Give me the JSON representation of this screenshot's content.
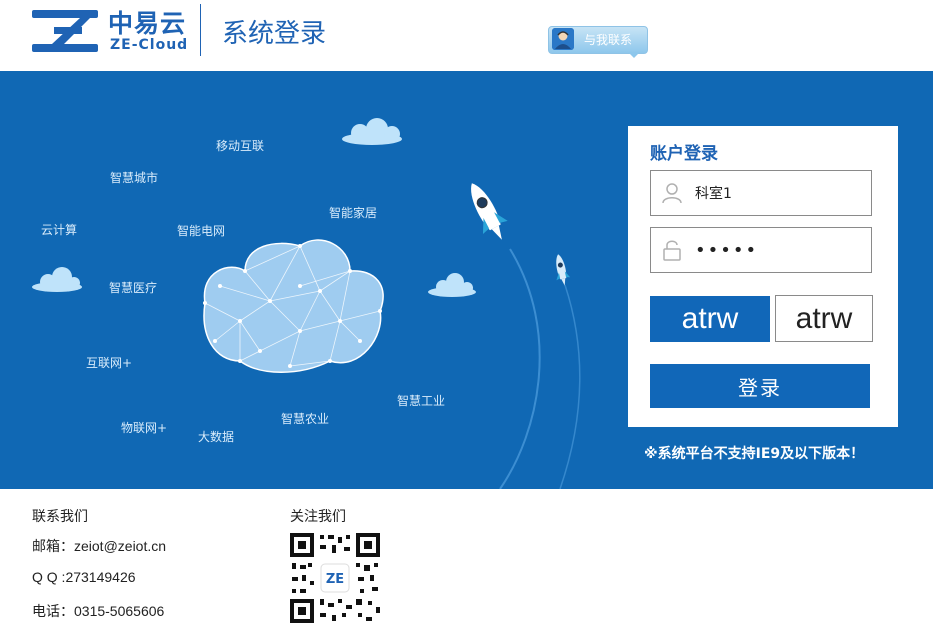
{
  "header": {
    "logo_cn": "中易云",
    "logo_en": "ZE-Cloud",
    "page_title": "系统登录",
    "contact_button": "与我联系"
  },
  "banner": {
    "keywords": [
      "移动互联",
      "智慧城市",
      "智能家居",
      "云计算",
      "智能电网",
      "智慧医疗",
      "互联网+",
      "智慧工业",
      "智慧农业",
      "物联网+",
      "大数据"
    ],
    "background_color": "#1068b4"
  },
  "login": {
    "title": "账户登录",
    "username_value": "科室1",
    "password_value": "•••••",
    "captcha_image_text": "atrw",
    "captcha_input_value": "atrw",
    "submit_label": "登录",
    "browser_note": "※系统平台不支持IE9及以下版本！",
    "accent_color": "#1167b8"
  },
  "footer": {
    "contact": {
      "title": "联系我们",
      "email": "邮箱：zeiot@zeiot.cn",
      "qq": "Q Q :273149426",
      "phone": "电话：0315-5065606"
    },
    "follow": {
      "title": "关注我们"
    }
  }
}
